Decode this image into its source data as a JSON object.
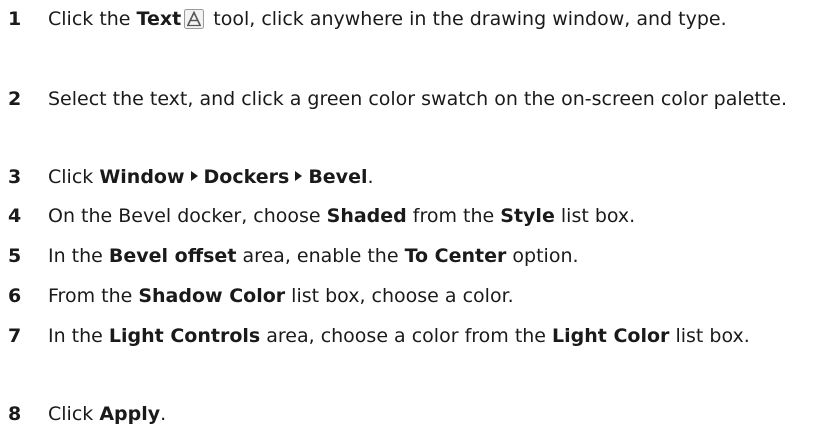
{
  "steps": [
    {
      "number": "1",
      "parts": [
        "Click the ",
        "Text",
        " tool, click anywhere in the drawing window, and type."
      ]
    },
    {
      "number": "2",
      "parts": [
        "Select the text, and click a green color swatch on the on-screen color palette."
      ]
    },
    {
      "number": "3",
      "parts": [
        "Click ",
        "Window",
        "Dockers",
        "Bevel",
        "."
      ]
    },
    {
      "number": "4",
      "parts": [
        "On the Bevel docker, choose ",
        "Shaded",
        " from the ",
        "Style",
        " list box."
      ]
    },
    {
      "number": "5",
      "parts": [
        "In the ",
        "Bevel offset",
        " area, enable the ",
        "To Center",
        " option."
      ]
    },
    {
      "number": "6",
      "parts": [
        "From the ",
        "Shadow Color",
        " list box, choose a color."
      ]
    },
    {
      "number": "7",
      "parts": [
        "In the ",
        "Light Controls",
        " area, choose a color from the ",
        "Light Color",
        " list box."
      ]
    },
    {
      "number": "8",
      "parts": [
        "Click ",
        "Apply",
        "."
      ]
    }
  ],
  "icons": {
    "text_tool": "text-tool-icon",
    "menu_arrow": "menu-arrow-icon"
  }
}
